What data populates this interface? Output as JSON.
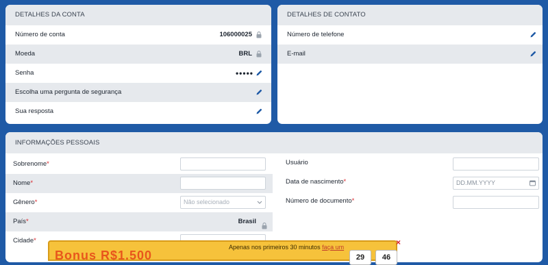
{
  "account": {
    "title": "DETALHES DA CONTA",
    "rows": [
      {
        "label": "Número de conta",
        "value": "106000025",
        "icon": "lock-icon"
      },
      {
        "label": "Moeda",
        "value": "BRL",
        "icon": "lock-icon"
      },
      {
        "label": "Senha",
        "value": "•••••",
        "icon": "pencil-icon"
      },
      {
        "label": "Escolha uma pergunta de segurança",
        "value": "",
        "icon": "pencil-icon"
      },
      {
        "label": "Sua resposta",
        "value": "",
        "icon": "pencil-icon"
      }
    ]
  },
  "contact": {
    "title": "DETALHES DE CONTATO",
    "rows": [
      {
        "label": "Número de telefone",
        "icon": "pencil-icon"
      },
      {
        "label": "E-mail",
        "icon": "pencil-icon"
      }
    ]
  },
  "personal": {
    "title": "INFORMAÇÕES PESSOAIS",
    "left": [
      {
        "label": "Sobrenome",
        "required": "*",
        "value": ""
      },
      {
        "label": "Nome",
        "required": "*",
        "value": ""
      },
      {
        "label": "Gênero",
        "required": "*",
        "placeholder": "Não selecionado"
      },
      {
        "label": "País",
        "required": "*",
        "value": "Brasil"
      },
      {
        "label": "Cidade",
        "required": "*",
        "value": ""
      }
    ],
    "right": [
      {
        "label": "Usuário",
        "required": "",
        "value": ""
      },
      {
        "label": "Data de nascimento",
        "required": "*",
        "placeholder": "DD.MM.YYYY"
      },
      {
        "label": "Número de documento",
        "required": "*",
        "value": ""
      }
    ]
  },
  "promo": {
    "text": "Apenas nos primeiros 30 minutos",
    "link": "faça um",
    "big": "Bonus R$1.500",
    "timer_min": "29",
    "timer_sec": "46",
    "close": "×"
  },
  "colors": {
    "background": "#1f5aa6",
    "required": "#d9262c",
    "banner": "#f6c23b"
  }
}
